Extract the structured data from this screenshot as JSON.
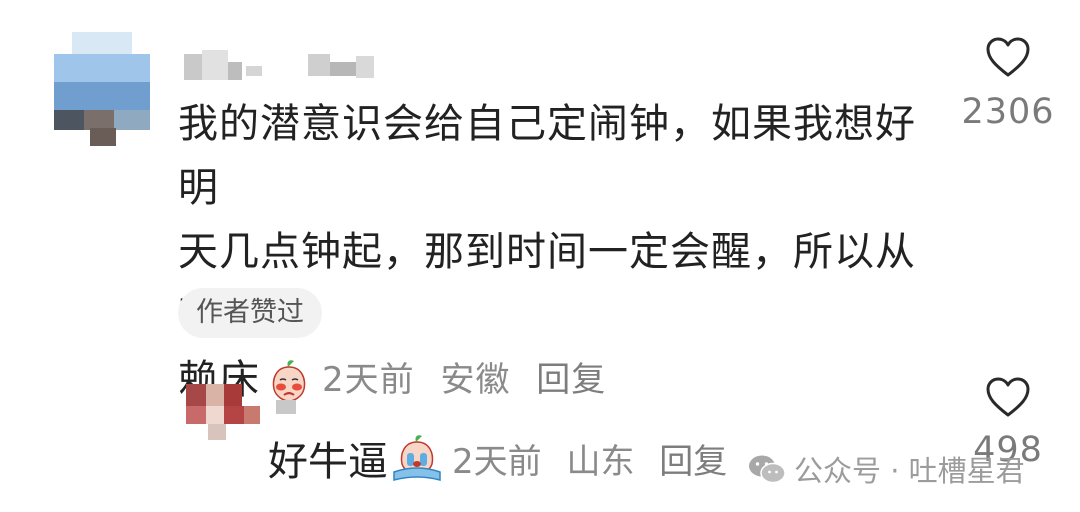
{
  "comments": [
    {
      "text_lines": [
        "我的潜意识会给自己定闹钟，如果我想好明",
        "天几点钟起，那到时间一定会醒，所以从不",
        "赖床"
      ],
      "emoji": "blushing-peach-emoji",
      "time": "2天前",
      "location": "安徽",
      "reply_label": "回复",
      "like_count": "2306",
      "author_liked_badge": "作者赞过"
    }
  ],
  "replies": [
    {
      "text": "好牛逼",
      "emoji": "crying-peach-emoji",
      "time": "2天前",
      "location": "山东",
      "reply_label": "回复",
      "like_count": "498"
    }
  ],
  "watermark": {
    "text": "公众号 · 吐槽星君"
  }
}
